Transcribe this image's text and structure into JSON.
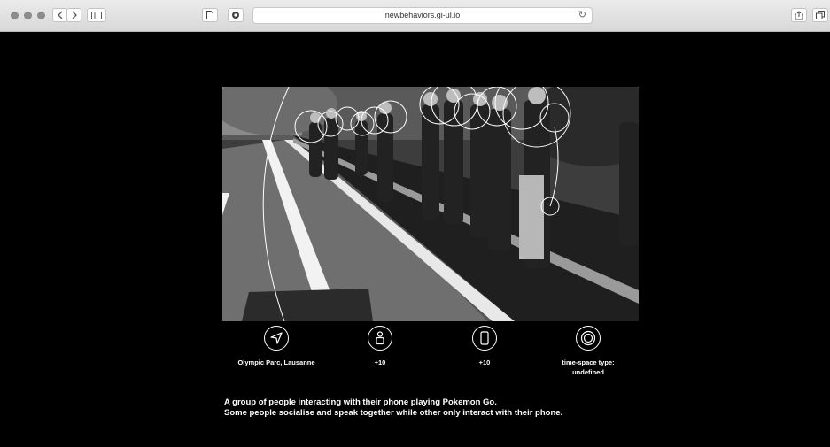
{
  "browser": {
    "url": "newbehaviors.gi-ul.io"
  },
  "photo": {
    "description_icon": "photo-pokemon-go-group"
  },
  "info": {
    "location": "Olympic Parc, Lausanne",
    "people": "+10",
    "phones": "+10",
    "timespace_line1": "time-space type:",
    "timespace_line2": "undefined"
  },
  "description": {
    "line1": "A group of people interacting with their phone playing Pokemon Go.",
    "line2": "Some people socialise and speak together while other only interact with their phone."
  }
}
